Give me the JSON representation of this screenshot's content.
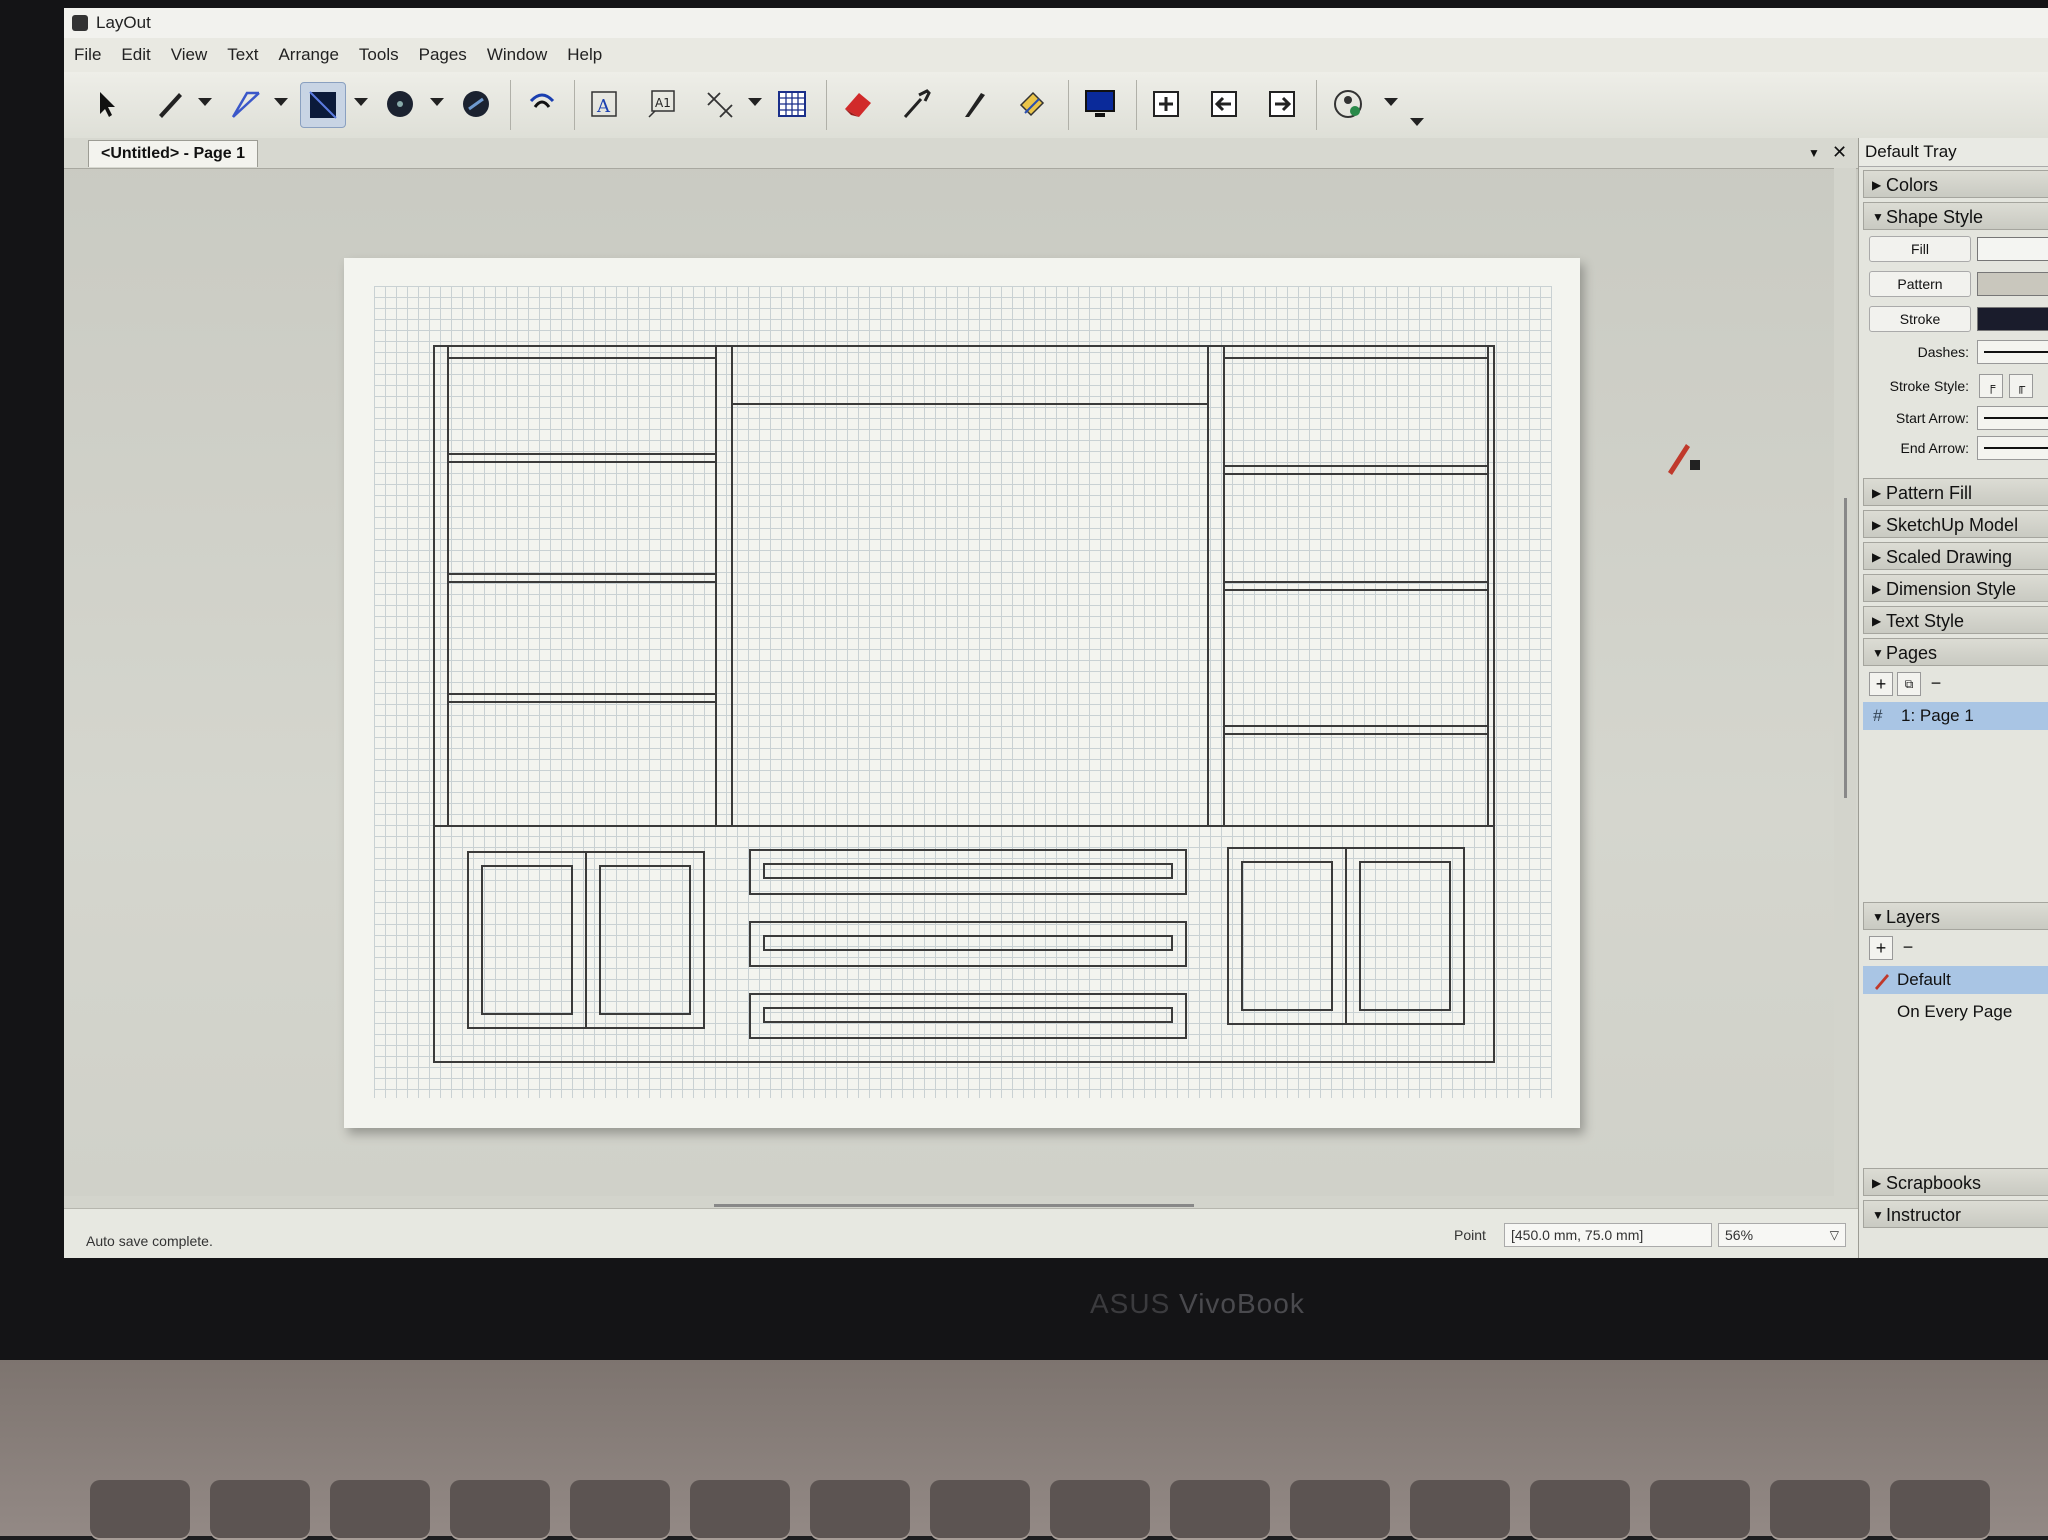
{
  "window": {
    "title": "LayOut"
  },
  "menu": [
    "File",
    "Edit",
    "View",
    "Text",
    "Arrange",
    "Tools",
    "Pages",
    "Window",
    "Help"
  ],
  "toolbar": {
    "tools": [
      "select-icon",
      "pencil-icon",
      "line-icon",
      "rectangle-icon",
      "circle-icon",
      "polygon-icon",
      "offset-icon",
      "text-icon",
      "label-icon",
      "dimension-icon",
      "table-icon",
      "eraser-icon",
      "eyedropper-icon",
      "style-brush-icon",
      "split-icon",
      "display-icon",
      "add-page-icon",
      "previous-page-icon",
      "next-page-icon",
      "collaborate-icon"
    ]
  },
  "document": {
    "tab_label": "<Untitled> - Page 1"
  },
  "status": {
    "message": "Auto save complete.",
    "point_label": "Point",
    "point_value": "[450.0 mm, 75.0 mm]",
    "zoom": "56%"
  },
  "tray": {
    "title": "Default Tray",
    "colors": "Colors",
    "shape_style": "Shape Style",
    "fill": "Fill",
    "pattern": "Pattern",
    "stroke": "Stroke",
    "dashes": "Dashes:",
    "stroke_style": "Stroke Style:",
    "start_arrow": "Start Arrow:",
    "end_arrow": "End Arrow:",
    "pattern_fill": "Pattern Fill",
    "sketchup_model": "SketchUp Model",
    "scaled_drawing": "Scaled Drawing",
    "dimension_style": "Dimension Style",
    "text_style": "Text Style",
    "pages": "Pages",
    "page_hash": "#",
    "page_item": "1:  Page 1",
    "layers": "Layers",
    "layer_default": "Default",
    "layer_every_page": "On Every Page",
    "scrapbooks": "Scrapbooks",
    "instructor": "Instructor",
    "fill_color": "#f4f5f2",
    "pattern_color": "#c9c7bd",
    "stroke_color": "#1a1c2c"
  },
  "bezel": {
    "brand_a": "ASUS",
    "brand_b": "VivoBook"
  }
}
